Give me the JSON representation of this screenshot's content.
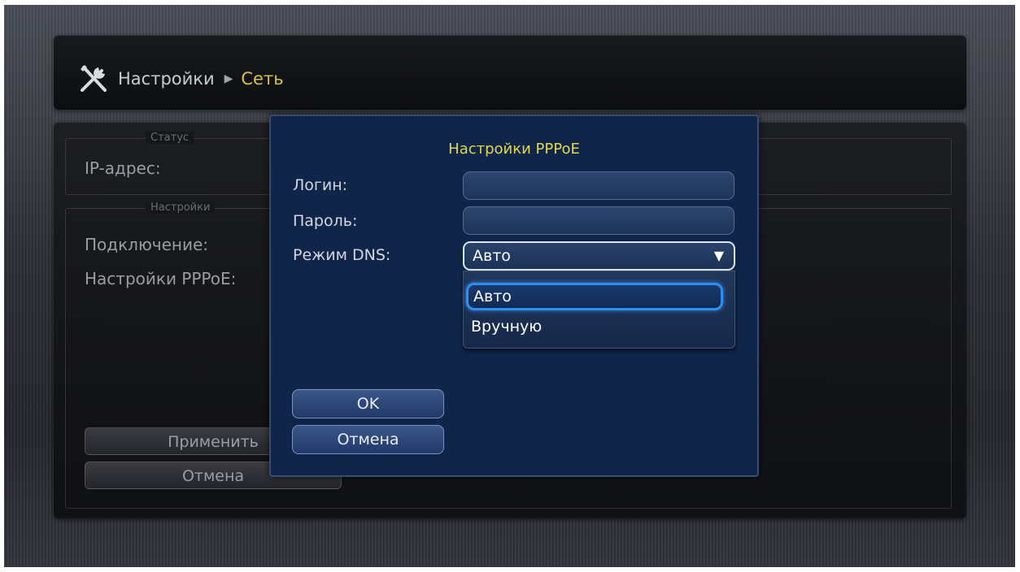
{
  "breadcrumb": {
    "icon": "tools-icon",
    "root": "Настройки",
    "separator_icon": "triangle-right-icon",
    "current": "Сеть"
  },
  "background": {
    "status_group_title": "Статус",
    "ip_label": "IP-адрес:",
    "settings_group_title": "Настройки",
    "connection_label": "Подключение:",
    "pppoe_label": "Настройки PPPoE:",
    "apply_button": "Применить",
    "cancel_button": "Отмена"
  },
  "dialog": {
    "title": "Настройки PPPoE",
    "login_label": "Логин:",
    "login_value": "",
    "password_label": "Пароль:",
    "password_value": "",
    "dns_label": "Режим DNS:",
    "dns_selected": "Авто",
    "dns_options": [
      "Авто",
      "Вручную"
    ],
    "ok_button": "OK",
    "cancel_button": "Отмена"
  },
  "colors": {
    "accent_yellow": "#d9c23a",
    "dialog_bg": "#0f2549",
    "focus_blue": "#2f8ff0"
  }
}
